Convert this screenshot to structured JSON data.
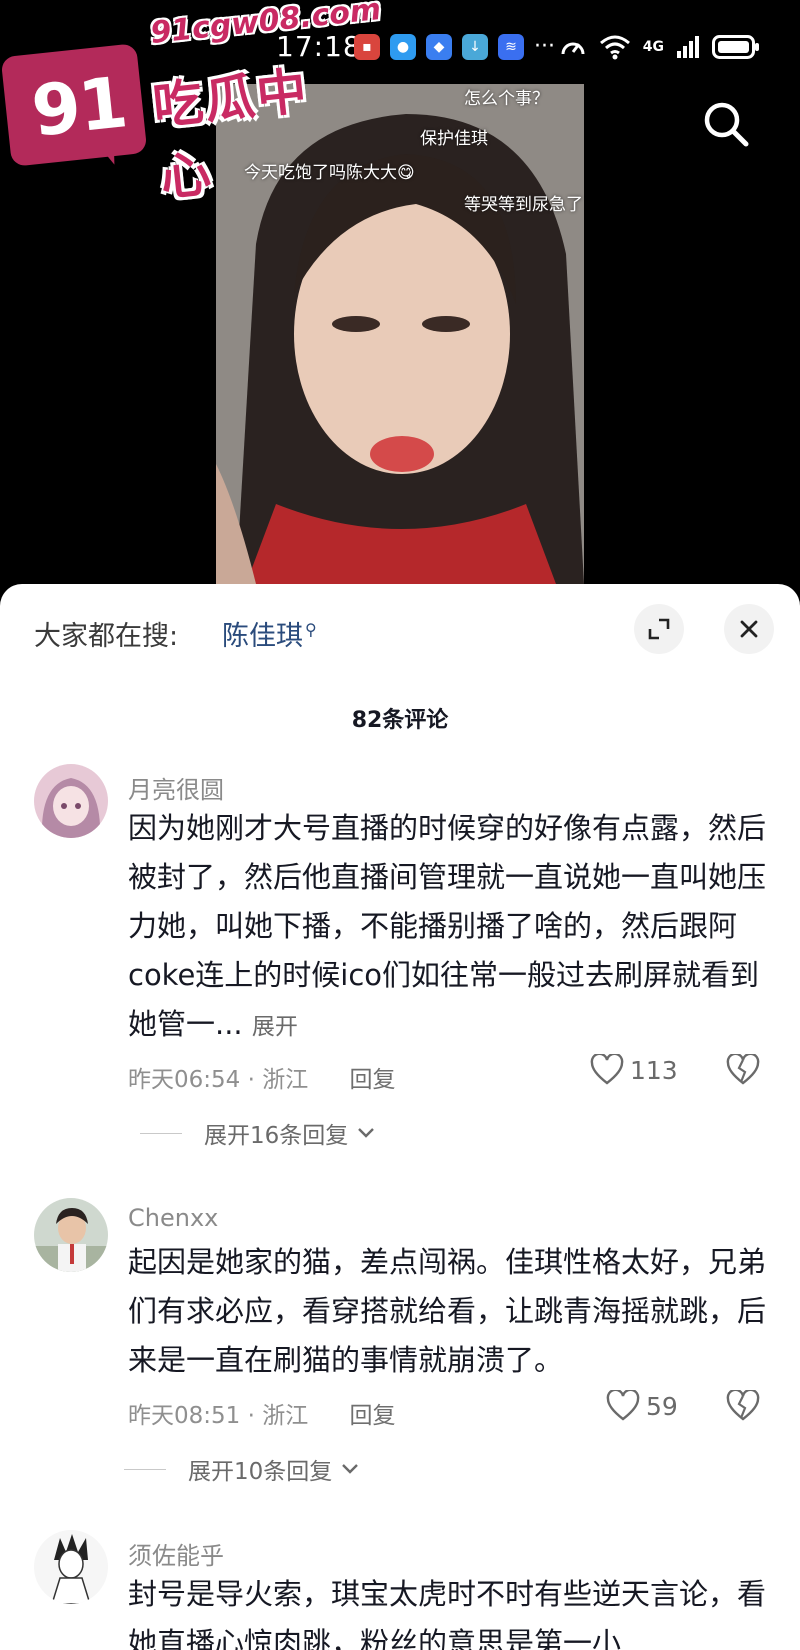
{
  "status_bar": {
    "time": "17:18",
    "network": "4G"
  },
  "watermark": {
    "number": "91",
    "url": "91cgw08.com",
    "name": "吃瓜中心"
  },
  "video": {
    "danmaku": [
      "怎么个事？",
      "保护佳琪",
      "今天吃饱了吗陈大大😋",
      "等哭等到尿急了"
    ]
  },
  "sheet": {
    "hot_search_label": "大家都在搜:",
    "hot_search_term": "陈佳琪",
    "comment_count": "82条评论"
  },
  "comments": [
    {
      "user": "月亮很圆",
      "text": "因为她刚才大号直播的时候穿的好像有点露，然后被封了，然后他直播间管理就一直说她一直叫她压力她，叫她下播，不能播别播了啥的，然后跟阿coke连上的时候ico们如往常一般过去刷屏就看到她管一...",
      "more_label": "展开",
      "time": "昨天06:54",
      "location": "浙江",
      "reply_label": "回复",
      "likes": "113",
      "replies_label": "展开16条回复"
    },
    {
      "user": "Chenxx",
      "text": "起因是她家的猫，差点闯祸。佳琪性格太好，兄弟们有求必应，看穿搭就给看，让跳青海摇就跳，后来是一直在刷猫的事情就崩溃了。",
      "time": "昨天08:51",
      "location": "浙江",
      "reply_label": "回复",
      "likes": "59",
      "replies_label": "展开10条回复"
    },
    {
      "user": "须佐能乎",
      "text": "封号是导火索，琪宝太虎时不时有些逆天言论，看她直播心惊肉跳，粉丝的意思是第一小"
    }
  ],
  "meta_separator": "·"
}
